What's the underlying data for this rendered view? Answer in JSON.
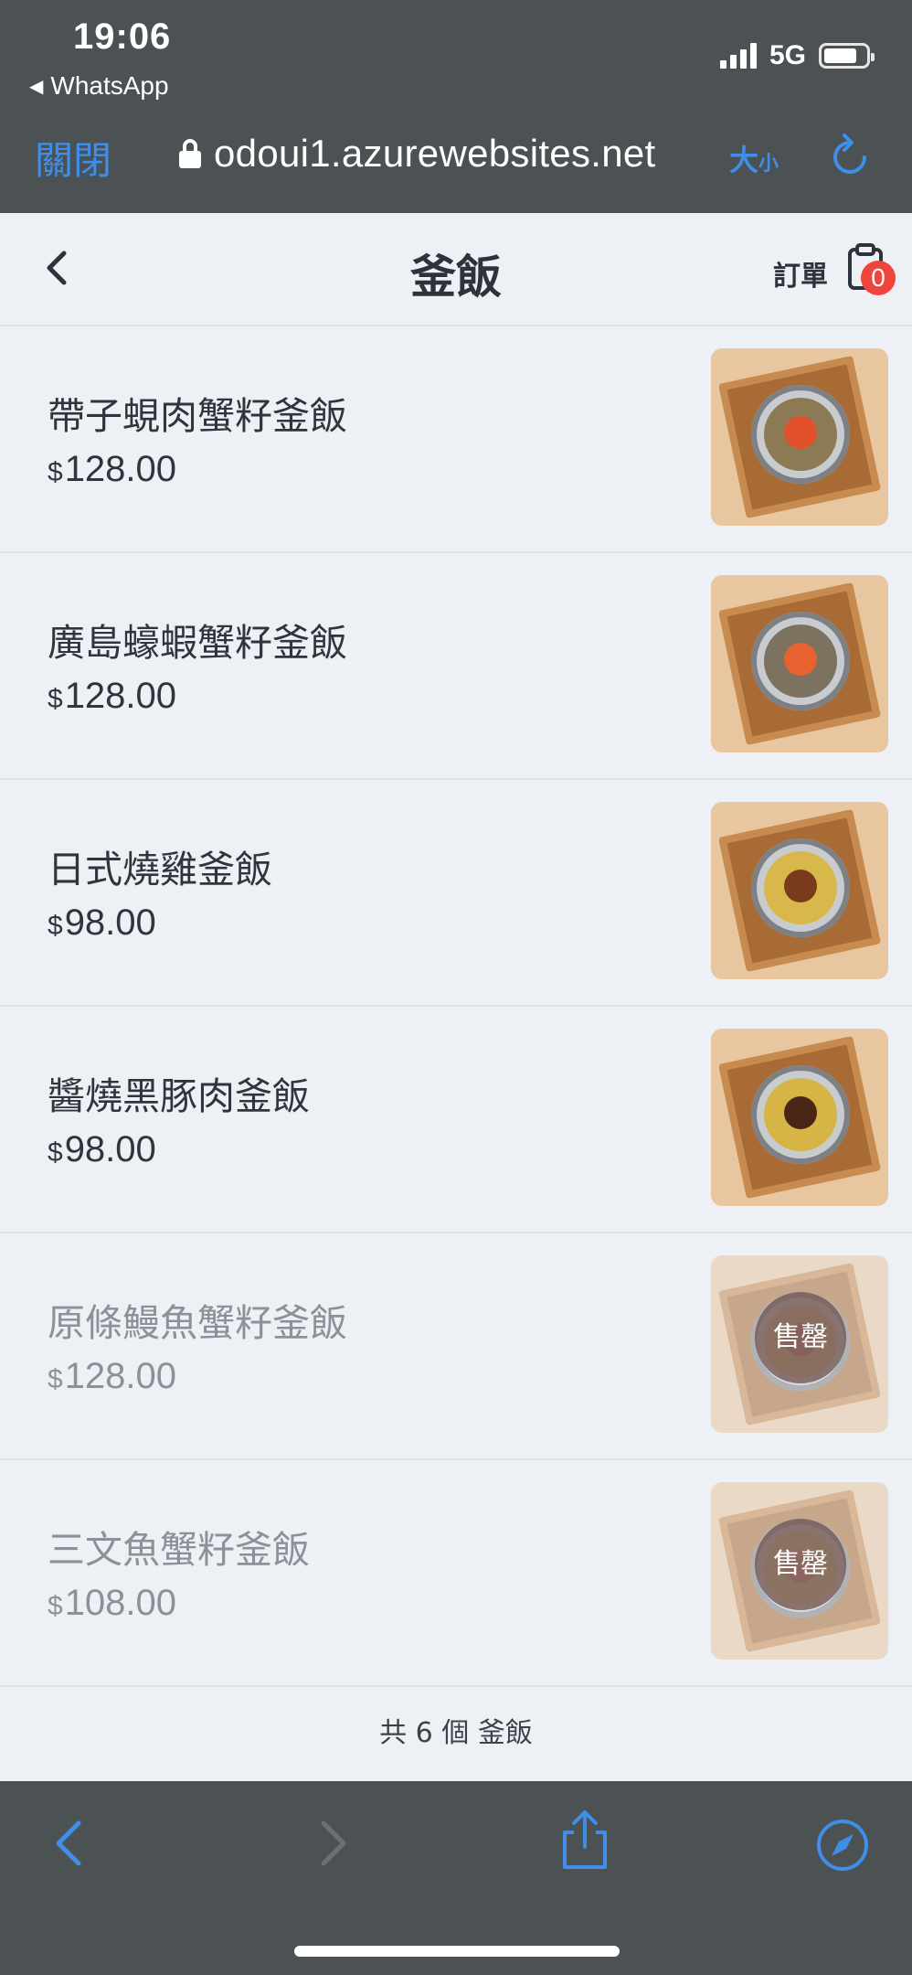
{
  "status_bar": {
    "time": "19:06",
    "back_app": "WhatsApp",
    "network": "5G"
  },
  "browser": {
    "close_label": "關閉",
    "url": "odoui1.azurewebsites.net",
    "size_label_big": "大",
    "size_label_small": "小"
  },
  "header": {
    "title": "釜飯",
    "order_label": "訂單",
    "cart_count": "0"
  },
  "items": [
    {
      "name": "帶子蜆肉蟹籽釜飯",
      "currency": "$",
      "price": "128.00",
      "sold_out": false,
      "rice": "#8c7a55",
      "topping": "#e0502a"
    },
    {
      "name": "廣島蠔蝦蟹籽釜飯",
      "currency": "$",
      "price": "128.00",
      "sold_out": false,
      "rice": "#7d7260",
      "topping": "#e8622f"
    },
    {
      "name": "日式燒雞釜飯",
      "currency": "$",
      "price": "98.00",
      "sold_out": false,
      "rice": "#d8b84a",
      "topping": "#7a3a1c"
    },
    {
      "name": "醬燒黑豚肉釜飯",
      "currency": "$",
      "price": "98.00",
      "sold_out": false,
      "rice": "#d6b445",
      "topping": "#4a2616"
    },
    {
      "name": "原條鰻魚蟹籽釜飯",
      "currency": "$",
      "price": "128.00",
      "sold_out": true,
      "sold_out_label": "售罄",
      "rice": "#c9a65a",
      "topping": "#b04a2a"
    },
    {
      "name": "三文魚蟹籽釜飯",
      "currency": "$",
      "price": "108.00",
      "sold_out": true,
      "sold_out_label": "售罄",
      "rice": "#d9be5a",
      "topping": "#e0704a"
    }
  ],
  "footer": {
    "count_text": "共 6 個 釜飯"
  },
  "colors": {
    "accent": "#3f8ee8",
    "chrome": "#4c5154",
    "badge": "#f0453c"
  }
}
